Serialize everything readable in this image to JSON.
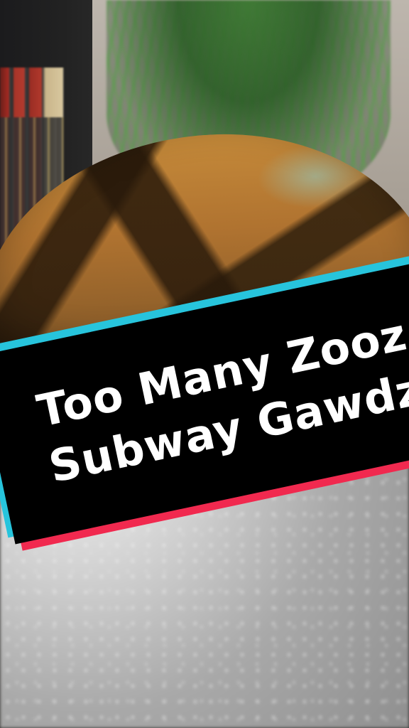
{
  "title": {
    "line1": "Too Many Zooz:",
    "line2": "Subway Gawdz"
  },
  "colors": {
    "banner_fill": "#000000",
    "banner_accent_top": "#27c4dc",
    "banner_accent_bottom": "#f1294f",
    "title_text": "#ffffff"
  }
}
